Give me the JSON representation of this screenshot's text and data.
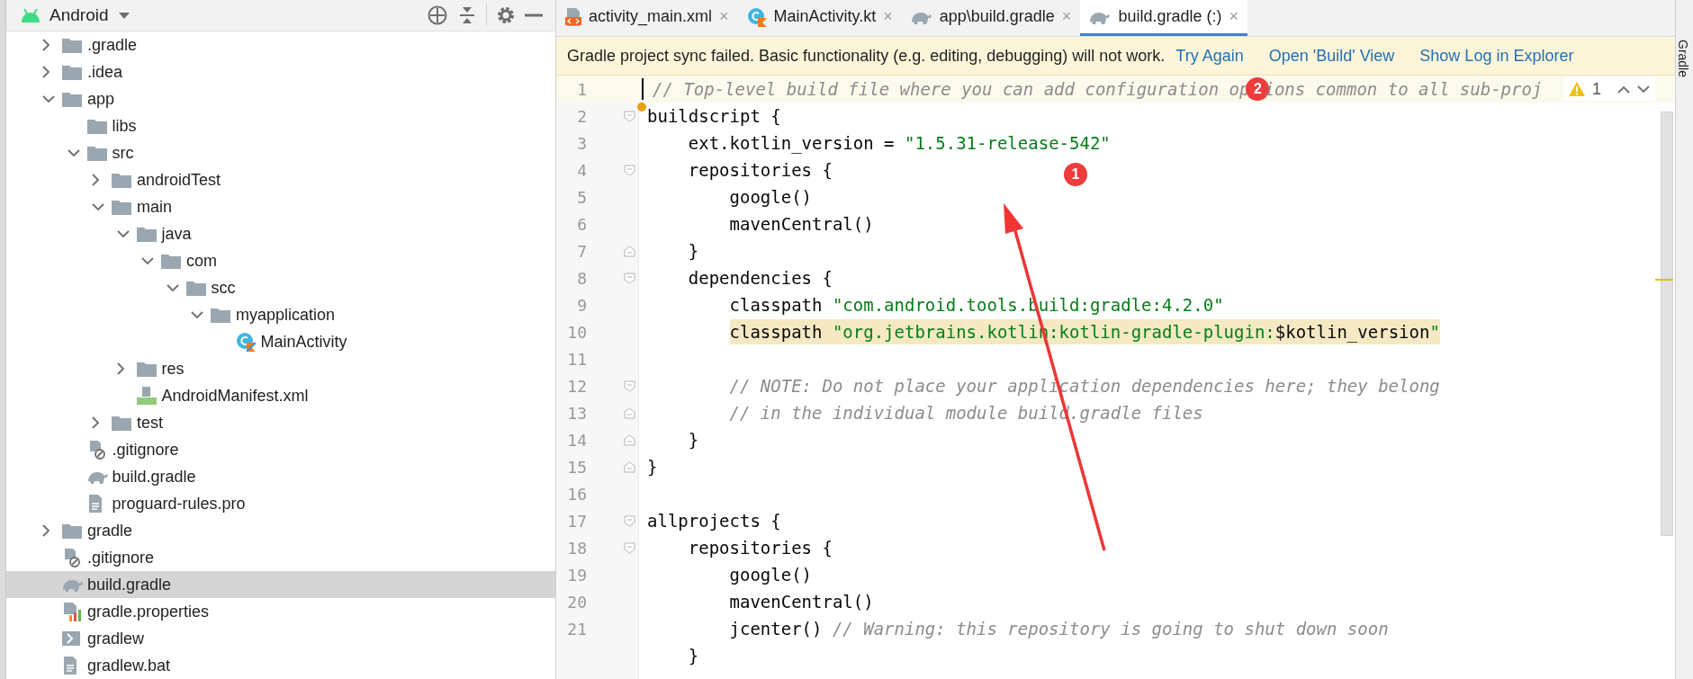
{
  "project": {
    "view": "Android",
    "tree": [
      {
        "label": ".gradle",
        "kind": "folder",
        "expanded": false,
        "selected": false
      },
      {
        "label": ".idea",
        "kind": "folder",
        "expanded": false,
        "selected": false
      },
      {
        "label": "app",
        "kind": "folder",
        "expanded": true,
        "selected": false,
        "children": [
          {
            "label": "libs",
            "kind": "folder",
            "selected": false
          },
          {
            "label": "src",
            "kind": "folder",
            "expanded": true,
            "selected": false,
            "children": [
              {
                "label": "androidTest",
                "kind": "folder",
                "expanded": false,
                "selected": false
              },
              {
                "label": "main",
                "kind": "folder",
                "expanded": true,
                "selected": false,
                "children": [
                  {
                    "label": "java",
                    "kind": "folder",
                    "expanded": true,
                    "selected": false,
                    "children": [
                      {
                        "label": "com",
                        "kind": "folder",
                        "expanded": true,
                        "selected": false,
                        "children": [
                          {
                            "label": "scc",
                            "kind": "folder",
                            "expanded": true,
                            "selected": false,
                            "children": [
                              {
                                "label": "myapplication",
                                "kind": "folder",
                                "expanded": true,
                                "selected": false,
                                "children": [
                                  {
                                    "label": "MainActivity",
                                    "kind": "kotlin",
                                    "selected": false
                                  }
                                ]
                              }
                            ]
                          }
                        ]
                      }
                    ]
                  },
                  {
                    "label": "res",
                    "kind": "folder",
                    "expanded": false,
                    "selected": false
                  },
                  {
                    "label": "AndroidManifest.xml",
                    "kind": "manifest",
                    "selected": false
                  }
                ]
              },
              {
                "label": "test",
                "kind": "folder",
                "expanded": false,
                "selected": false
              }
            ]
          },
          {
            "label": ".gitignore",
            "kind": "gitignore",
            "selected": false
          },
          {
            "label": "build.gradle",
            "kind": "gradle",
            "selected": false
          },
          {
            "label": "proguard-rules.pro",
            "kind": "text",
            "selected": false
          }
        ]
      },
      {
        "label": "gradle",
        "kind": "folder",
        "expanded": false,
        "selected": false
      },
      {
        "label": ".gitignore",
        "kind": "gitignore",
        "selected": false
      },
      {
        "label": "build.gradle",
        "kind": "gradle",
        "selected": true
      },
      {
        "label": "gradle.properties",
        "kind": "properties",
        "selected": false
      },
      {
        "label": "gradlew",
        "kind": "terminal",
        "selected": false
      },
      {
        "label": "gradlew.bat",
        "kind": "text",
        "selected": false
      }
    ]
  },
  "tabs": [
    {
      "label": "activity_main.xml",
      "kind": "xml",
      "selected": false,
      "close": "×"
    },
    {
      "label": "MainActivity.kt",
      "kind": "kotlin",
      "selected": false,
      "close": "×"
    },
    {
      "label": "app\\build.gradle",
      "kind": "gradle",
      "selected": false,
      "close": "×"
    },
    {
      "label": "build.gradle (:)",
      "kind": "gradle",
      "selected": true,
      "close": "×"
    }
  ],
  "banner": {
    "message": "Gradle project sync failed. Basic functionality (e.g. editing, debugging) will not work.",
    "links": [
      "Try Again",
      "Open 'Build' View",
      "Show Log in Explorer"
    ]
  },
  "inspection": {
    "warnings": "1"
  },
  "code": [
    {
      "number": "1",
      "kind": "line",
      "current": true,
      "highlighted": false,
      "segments": [
        {
          "kind": "comment",
          "text": "// Top-level build file where you can add configuration op"
        },
        {
          "kind": "callout",
          "text": "2"
        },
        {
          "kind": "comment",
          "text": "ions common to all sub-proj"
        }
      ]
    },
    {
      "number": "2",
      "kind": "fold_start",
      "current": false,
      "highlighted": false,
      "segments": [
        {
          "kind": "plain",
          "text": "buildscript {"
        }
      ]
    },
    {
      "number": "3",
      "kind": "line",
      "current": false,
      "highlighted": false,
      "segments": [
        {
          "kind": "plain",
          "text": "    ext.kotlin_version = "
        },
        {
          "kind": "string",
          "text": "\"1.5.31-release-542\""
        }
      ]
    },
    {
      "number": "4",
      "kind": "fold_start",
      "current": false,
      "highlighted": false,
      "segments": [
        {
          "kind": "plain",
          "text": "    repositories {"
        }
      ]
    },
    {
      "number": "5",
      "kind": "line",
      "current": false,
      "highlighted": false,
      "segments": [
        {
          "kind": "plain",
          "text": "        google()"
        }
      ]
    },
    {
      "number": "6",
      "kind": "line",
      "current": false,
      "highlighted": false,
      "segments": [
        {
          "kind": "plain",
          "text": "        mavenCentral()"
        }
      ]
    },
    {
      "number": "7",
      "kind": "fold_end",
      "current": false,
      "highlighted": false,
      "segments": [
        {
          "kind": "plain",
          "text": "    }"
        }
      ]
    },
    {
      "number": "8",
      "kind": "fold_start",
      "current": false,
      "highlighted": false,
      "segments": [
        {
          "kind": "plain",
          "text": "    dependencies {"
        }
      ]
    },
    {
      "number": "9",
      "kind": "line",
      "current": false,
      "highlighted": false,
      "segments": [
        {
          "kind": "plain",
          "text": "        classpath "
        },
        {
          "kind": "string",
          "text": "\"com.android.tools.build:gradle:4.2.0\""
        }
      ]
    },
    {
      "number": "10",
      "kind": "line",
      "current": false,
      "highlighted": true,
      "segments": [
        {
          "kind": "plain",
          "text": "        classpath "
        },
        {
          "kind": "string",
          "text": "\"org.jetbrains.kotlin:kotlin-gradle-plugin:"
        },
        {
          "kind": "plain",
          "text": "$kotlin_version"
        },
        {
          "kind": "string",
          "text": "\""
        }
      ]
    },
    {
      "number": "11",
      "kind": "line"
    },
    {
      "number": "12",
      "kind": "fold_start",
      "current": false,
      "highlighted": false,
      "segments": [
        {
          "kind": "comment",
          "text": "        // NOTE: Do not place your application dependencies here; they belong"
        }
      ]
    },
    {
      "number": "13",
      "kind": "fold_end",
      "current": false,
      "highlighted": false,
      "segments": [
        {
          "kind": "comment",
          "text": "        // in the individual module build.gradle files"
        }
      ]
    },
    {
      "number": "14",
      "kind": "fold_end",
      "current": false,
      "highlighted": false,
      "segments": [
        {
          "kind": "plain",
          "text": "    }"
        }
      ]
    },
    {
      "number": "15",
      "kind": "fold_end",
      "current": false,
      "highlighted": false,
      "segments": [
        {
          "kind": "plain",
          "text": "}"
        }
      ]
    },
    {
      "number": "16",
      "kind": "line"
    },
    {
      "number": "17",
      "kind": "fold_start",
      "current": false,
      "highlighted": false,
      "segments": [
        {
          "kind": "plain",
          "text": "allprojects {"
        }
      ]
    },
    {
      "number": "18",
      "kind": "fold_start",
      "current": false,
      "highlighted": false,
      "segments": [
        {
          "kind": "plain",
          "text": "    repositories {"
        }
      ]
    },
    {
      "number": "19",
      "kind": "line",
      "current": false,
      "highlighted": false,
      "segments": [
        {
          "kind": "plain",
          "text": "        google()"
        }
      ]
    },
    {
      "number": "20",
      "kind": "line",
      "current": false,
      "highlighted": false,
      "segments": [
        {
          "kind": "plain",
          "text": "        mavenCentral()"
        }
      ]
    },
    {
      "number": "21",
      "kind": "line",
      "current": false,
      "highlighted": false,
      "segments": [
        {
          "kind": "plain",
          "text": "        jcenter() "
        },
        {
          "kind": "comment",
          "text": "// Warning: this repository is going to shut down soon"
        }
      ]
    },
    {
      "kind": "line",
      "current": false,
      "highlighted": false,
      "segments": [
        {
          "kind": "plain",
          "text": "    }"
        }
      ]
    }
  ],
  "annotations": [
    {
      "label": "1"
    }
  ],
  "side_tool": "Gradle"
}
